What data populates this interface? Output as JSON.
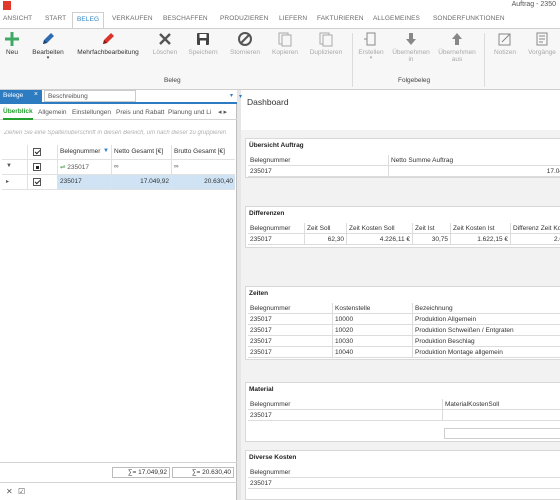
{
  "window": {
    "title": "Auftrag - 2350"
  },
  "menu": {
    "tabs": [
      "ANSICHT",
      "START",
      "BELEG",
      "VERKAUFEN",
      "BESCHAFFEN",
      "PRODUZIEREN",
      "LIEFERN",
      "FAKTURIEREN",
      "ALLGEMEINES",
      "SONDERFUNKTIONEN"
    ],
    "active": "BELEG"
  },
  "ribbon": {
    "new": "Neu",
    "edit": "Bearbeiten",
    "multi_edit": "Mehrfachbearbeitung",
    "delete": "Löschen",
    "save": "Speichern",
    "cancel": "Stornieren",
    "copy": "Kopieren",
    "duplicate": "Duplizieren",
    "group_beleg": "Beleg",
    "create": "Erstellen",
    "take_in": "Übernehmen in",
    "take_from": "Übernehmen aus",
    "group_folgebeleg": "Folgebeleg",
    "notes": "Notizen",
    "processes": "Vorgänge"
  },
  "left_panel": {
    "tab_belege": "Belege",
    "tab_beschreibung": "Beschreibung",
    "subtabs": [
      "Überblick",
      "Allgemein",
      "Einstellungen",
      "Preis und Rabatt",
      "Planung und Li"
    ],
    "group_hint": "Ziehen Sie eine Spaltenüberschrift in diesen Bereich, um nach dieser zu gruppieren",
    "columns": {
      "belegnummer": "Belegnummer",
      "netto": "Netto Gesamt [€]",
      "brutto": "Brutto Gesamt [€]"
    },
    "filter": {
      "belegnummer": "235017",
      "netto": "∞",
      "brutto": "∞"
    },
    "rows": [
      {
        "belegnummer": "235017",
        "netto": "17.049,92",
        "brutto": "20.630,40"
      }
    ],
    "sums": {
      "netto": "∑= 17.049,92",
      "brutto": "∑= 20.630,40"
    }
  },
  "dashboard": {
    "title": "Dashboard",
    "uebersicht": {
      "title": "Übersicht Auftrag",
      "headers": [
        "Belegnummer",
        "Netto Summe Auftrag"
      ],
      "rows": [
        [
          "235017",
          "17.04"
        ]
      ]
    },
    "differenzen": {
      "title": "Differenzen",
      "headers": [
        "Belegnummer",
        "Zeit Soll",
        "Zeit Kosten Soll",
        "Zeit Ist",
        "Zeit Kosten Ist",
        "Differenz Zeit Ko"
      ],
      "rows": [
        [
          "235017",
          "62,30",
          "4.226,11 €",
          "30,75",
          "1.622,15 €",
          "2.6"
        ]
      ]
    },
    "zeiten": {
      "title": "Zeiten",
      "headers": [
        "Belegnummer",
        "Kostenstelle",
        "Bezeichnung"
      ],
      "rows": [
        [
          "235017",
          "10000",
          "Produktion Allgemein"
        ],
        [
          "235017",
          "10020",
          "Produktion Schweißen / Entgraten"
        ],
        [
          "235017",
          "10030",
          "Produktion Beschlag"
        ],
        [
          "235017",
          "10040",
          "Produktion Montage allgemein"
        ]
      ]
    },
    "material": {
      "title": "Material",
      "headers": [
        "Belegnummer",
        "MaterialKostenSoll"
      ],
      "rows": [
        [
          "235017",
          ""
        ]
      ]
    },
    "diverse": {
      "title": "Diverse Kosten",
      "headers": [
        "Belegnummer"
      ],
      "rows": [
        [
          "235017"
        ]
      ]
    }
  },
  "colors": {
    "accent": "#2d7cc1",
    "active_tab": "#2e84c6",
    "green": "#23a02e",
    "selection": "#cfe3f4"
  }
}
